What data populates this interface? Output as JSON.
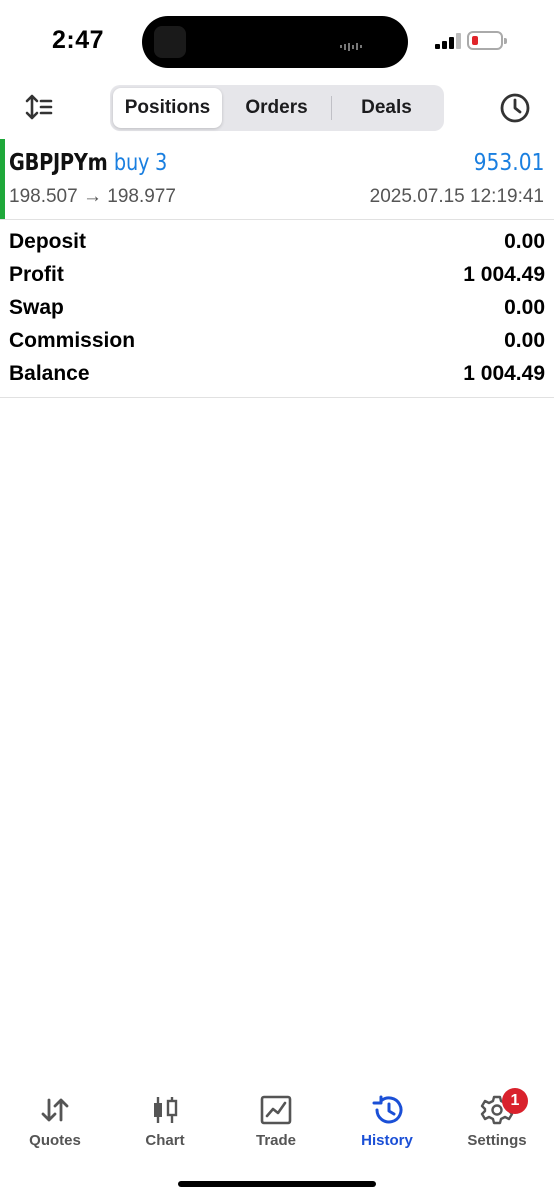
{
  "status_bar": {
    "time": "2:47"
  },
  "tabs": [
    {
      "label": "Positions",
      "active": true
    },
    {
      "label": "Orders",
      "active": false
    },
    {
      "label": "Deals",
      "active": false
    }
  ],
  "trade": {
    "symbol": "GBPJPYm",
    "side": "buy 3",
    "profit": "953.01",
    "open_price": "198.507",
    "arrow": "→",
    "close_price": "198.977",
    "time": "2025.07.15 12:19:41",
    "accent_color": "#1fa83a"
  },
  "summary": [
    {
      "label": "Deposit",
      "value": "0.00"
    },
    {
      "label": "Profit",
      "value": "1 004.49"
    },
    {
      "label": "Swap",
      "value": "0.00"
    },
    {
      "label": "Commission",
      "value": "0.00"
    },
    {
      "label": "Balance",
      "value": "1 004.49"
    }
  ],
  "bottom_nav": [
    {
      "label": "Quotes",
      "icon": "quotes-icon",
      "active": false
    },
    {
      "label": "Chart",
      "icon": "chart-icon",
      "active": false
    },
    {
      "label": "Trade",
      "icon": "trade-icon",
      "active": false
    },
    {
      "label": "History",
      "icon": "history-icon",
      "active": true
    },
    {
      "label": "Settings",
      "icon": "settings-icon",
      "active": false,
      "badge": "1"
    }
  ],
  "colors": {
    "accent": "#1a7fe0",
    "active_tab": "#1a4fd6",
    "badge": "#d9212c",
    "buy_bar": "#1fa83a"
  }
}
